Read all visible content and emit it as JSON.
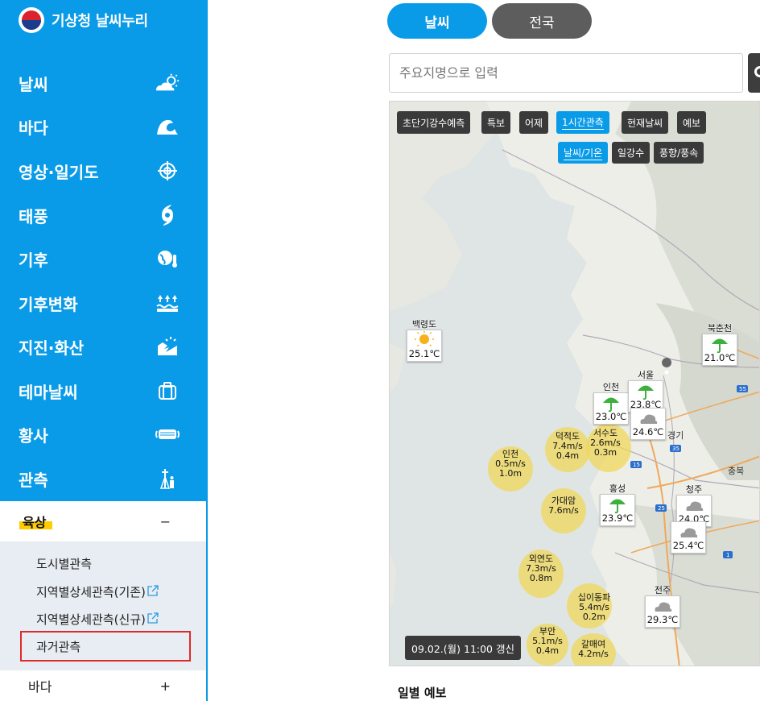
{
  "app": {
    "title": "기상청 날씨누리"
  },
  "sidebar": {
    "items": [
      {
        "label": "날씨",
        "icon": "weather-icon"
      },
      {
        "label": "바다",
        "icon": "wave-icon"
      },
      {
        "label": "영상·일기도",
        "icon": "satellite-icon"
      },
      {
        "label": "태풍",
        "icon": "typhoon-icon"
      },
      {
        "label": "기후",
        "icon": "globe-thermometer-icon"
      },
      {
        "label": "기후변화",
        "icon": "sea-level-icon"
      },
      {
        "label": "지진·화산",
        "icon": "earthquake-icon"
      },
      {
        "label": "테마날씨",
        "icon": "suitcase-icon"
      },
      {
        "label": "황사",
        "icon": "mask-icon"
      },
      {
        "label": "관측",
        "icon": "observation-tower-icon"
      }
    ],
    "sub_section": {
      "title": "육상",
      "toggle": "−",
      "items": [
        {
          "label": "도시별관측"
        },
        {
          "label": "지역별상세관측(기존)"
        },
        {
          "label": "지역별상세관측(신규)"
        },
        {
          "label": "과거관측"
        }
      ]
    },
    "next_section": {
      "title": "바다",
      "toggle": "+"
    }
  },
  "tabs": [
    {
      "label": "날씨"
    },
    {
      "label": "전국"
    }
  ],
  "search": {
    "placeholder": "주요지명으로 입력"
  },
  "map": {
    "buttons_row1": [
      "초단기강수예측",
      "특보",
      "어제",
      "1시간관측",
      "현재날씨",
      "예보"
    ],
    "buttons_row2": [
      "날씨/기온",
      "일강수",
      "풍향/풍속"
    ],
    "active_row1": "1시간관측",
    "active_row2": "날씨/기온",
    "timestamp": "09.02.(월) 11:00 갱신",
    "stations": [
      {
        "name": "백령도",
        "temp": "25.1℃",
        "weather": "sunny"
      },
      {
        "name": "인천",
        "temp": "23.0℃",
        "weather": "rain"
      },
      {
        "name": "서울",
        "temp": "23.8℃",
        "weather": "rain"
      },
      {
        "name": "",
        "temp": "24.6℃",
        "weather": "cloudy"
      },
      {
        "name": "북춘천",
        "temp": "21.0℃",
        "weather": "rain"
      },
      {
        "name": "홍성",
        "temp": "23.9℃",
        "weather": "rain"
      },
      {
        "name": "청주",
        "temp": "24.0℃",
        "weather": "cloudy"
      },
      {
        "name": "",
        "temp": "25.4℃",
        "weather": "cloudy"
      },
      {
        "name": "전주",
        "temp": "29.3℃",
        "weather": "cloudy"
      }
    ],
    "winds": [
      {
        "name": "인천",
        "speed": "0.5m/s",
        "height": "1.0m"
      },
      {
        "name": "덕적도",
        "speed": "7.4m/s",
        "height": "0.4m"
      },
      {
        "name": "서수도",
        "speed": "2.6m/s",
        "height": "0.3m"
      },
      {
        "name": "가대암",
        "speed": "7.6m/s",
        "height": ""
      },
      {
        "name": "외연도",
        "speed": "7.3m/s",
        "height": "0.8m"
      },
      {
        "name": "십이동파",
        "speed": "5.4m/s",
        "height": "0.2m"
      },
      {
        "name": "부안",
        "speed": "5.1m/s",
        "height": "0.4m"
      },
      {
        "name": "갈매여",
        "speed": "4.2m/s",
        "height": ""
      }
    ],
    "labels": [
      "경기",
      "충북",
      "15",
      "25",
      "35",
      "55",
      "1"
    ]
  },
  "daily": {
    "title": "일별 예보"
  },
  "colors": {
    "primary": "#0a9be8",
    "dark": "#3a3a3a",
    "highlight": "#ffcc00",
    "selected_border": "#e02a2a"
  }
}
